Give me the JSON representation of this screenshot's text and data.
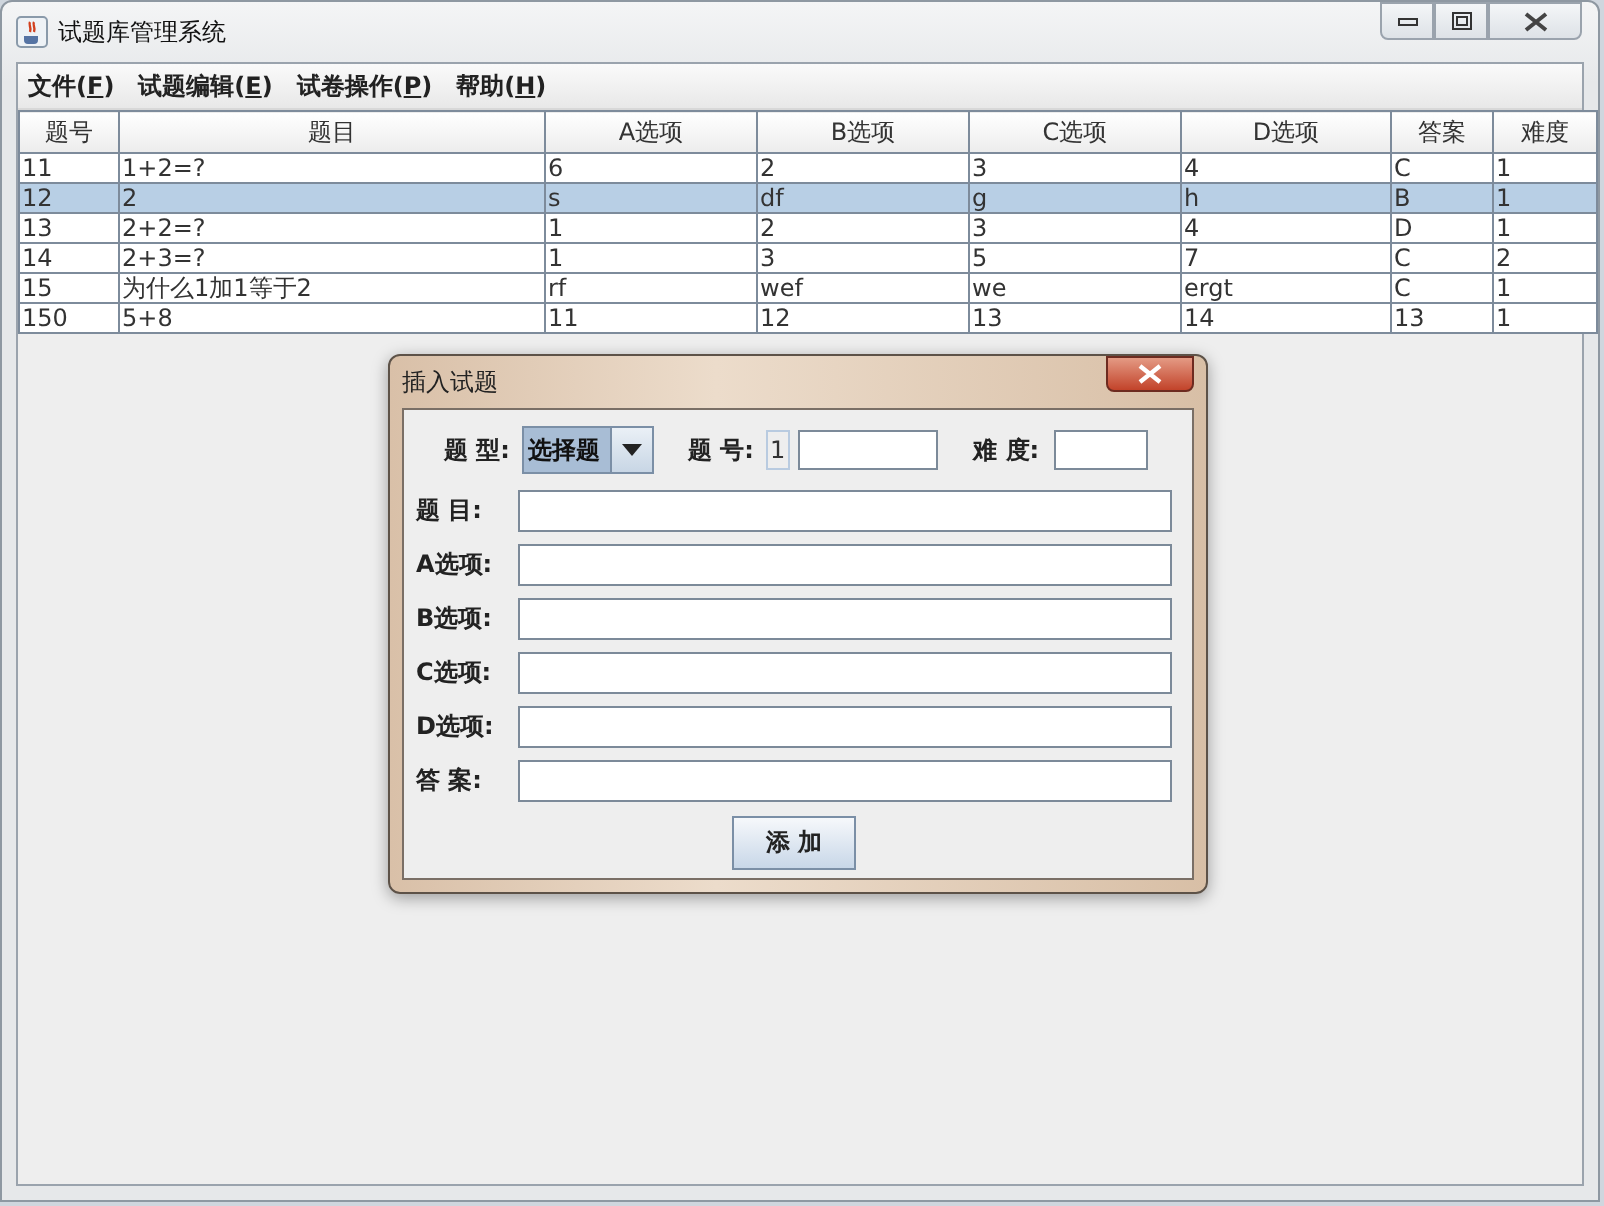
{
  "window": {
    "title": "试题库管理系统"
  },
  "menu": [
    {
      "before": "文件(",
      "key": "F",
      "after": ")"
    },
    {
      "before": "试题编辑(",
      "key": "E",
      "after": ")"
    },
    {
      "before": "试卷操作(",
      "key": "P",
      "after": ")"
    },
    {
      "before": "帮助(",
      "key": "H",
      "after": ")"
    }
  ],
  "table": {
    "columns": [
      "题号",
      "题目",
      "A选项",
      "B选项",
      "C选项",
      "D选项",
      "答案",
      "难度"
    ],
    "rows": [
      {
        "selected": false,
        "cells": [
          "11",
          "1+2=?",
          "6",
          "2",
          "3",
          "4",
          "C",
          "1"
        ]
      },
      {
        "selected": true,
        "cells": [
          "12",
          "2",
          "s",
          "df",
          "g",
          "h",
          "B",
          "1"
        ]
      },
      {
        "selected": false,
        "cells": [
          "13",
          "2+2=?",
          "1",
          "2",
          "3",
          "4",
          "D",
          "1"
        ]
      },
      {
        "selected": false,
        "cells": [
          "14",
          "2+3=?",
          "1",
          "3",
          "5",
          "7",
          "C",
          "2"
        ]
      },
      {
        "selected": false,
        "cells": [
          "15",
          "为什么1加1等于2",
          "rf",
          "wef",
          "we",
          "ergt",
          "C",
          "1"
        ]
      },
      {
        "selected": false,
        "cells": [
          "150",
          "5+8",
          "11",
          "12",
          "13",
          "14",
          "13",
          "1"
        ]
      }
    ]
  },
  "dialog": {
    "title": "插入试题",
    "type_label": "题 型:",
    "type_value": "选择题",
    "number_label": "题 号:",
    "number_prefix": "1",
    "difficulty_label": "难 度:",
    "fields": [
      "题 目:",
      "A选项:",
      "B选项:",
      "C选项:",
      "D选项:",
      "答 案:"
    ],
    "button": "添 加"
  }
}
